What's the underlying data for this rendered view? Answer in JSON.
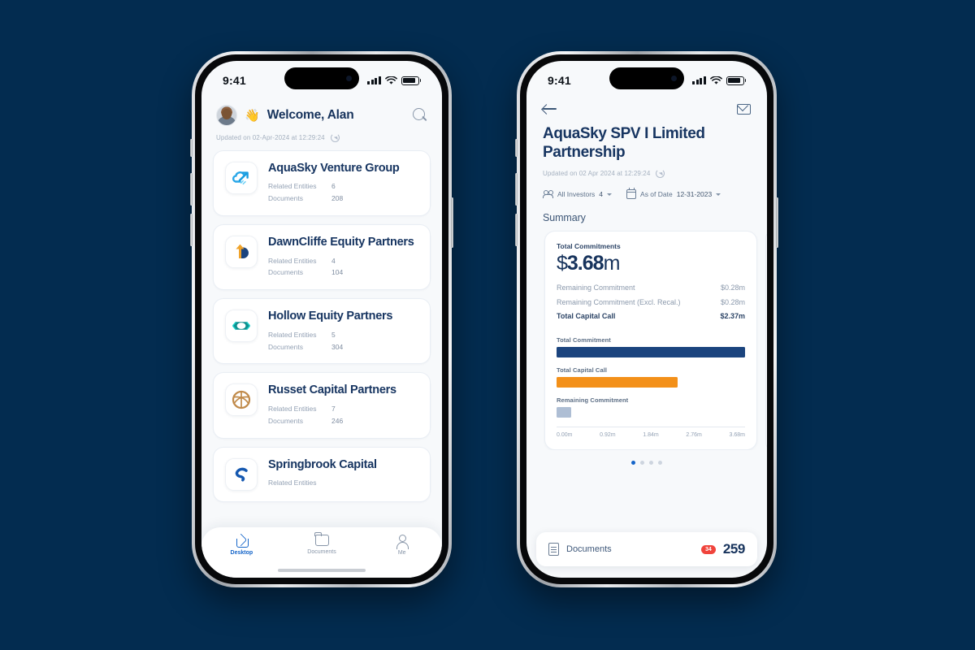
{
  "background_color": "#032c50",
  "accent_color": "#1565c9",
  "phone1": {
    "status_bar": {
      "time": "9:41",
      "signal_icon": "cellular-signal-icon",
      "wifi_icon": "wifi-icon",
      "battery_icon": "battery-icon"
    },
    "header": {
      "avatar": "user-avatar",
      "wave_emoji": "👋",
      "greeting": "Welcome, Alan",
      "search_icon": "search-icon"
    },
    "updated": {
      "text": "Updated on 02-Apr-2024 at 12:29:24",
      "refresh_icon": "refresh-icon"
    },
    "labels": {
      "related_entities": "Related Entities",
      "documents": "Documents"
    },
    "cards": [
      {
        "name": "AquaSky Venture Group",
        "logo": "cloud-arrow-logo",
        "related_entities": "6",
        "documents": "208"
      },
      {
        "name": "DawnCliffe Equity Partners",
        "logo": "arrow-d-logo",
        "related_entities": "4",
        "documents": "104"
      },
      {
        "name": "Hollow Equity Partners",
        "logo": "teal-hexagon-logo",
        "related_entities": "5",
        "documents": "304"
      },
      {
        "name": "Russet Capital Partners",
        "logo": "bronze-circle-logo",
        "related_entities": "7",
        "documents": "246"
      },
      {
        "name": "Springbrook Capital",
        "logo": "blue-s-logo",
        "related_entities": "",
        "documents": ""
      }
    ],
    "tabbar": [
      {
        "label": "Desktop",
        "icon": "home-icon",
        "active": true
      },
      {
        "label": "Documents",
        "icon": "folder-icon",
        "active": false
      },
      {
        "label": "Me",
        "icon": "person-icon",
        "active": false
      }
    ]
  },
  "phone2": {
    "status_bar": {
      "time": "9:41",
      "signal_icon": "cellular-signal-icon",
      "wifi_icon": "wifi-icon",
      "battery_icon": "battery-icon"
    },
    "nav": {
      "back_icon": "back-arrow-icon",
      "mail_icon": "mail-icon"
    },
    "title": "AquaSky SPV I Limited Partnership",
    "updated": {
      "text": "Updated on 02 Apr 2024 at 12:29:24",
      "refresh_icon": "refresh-icon"
    },
    "filters": [
      {
        "icon": "investors-group-icon",
        "label": "All Investors",
        "value": "4",
        "chevron": "chevron-down-icon"
      },
      {
        "icon": "calendar-icon",
        "label": "As of Date",
        "value": "12-31-2023",
        "chevron": "chevron-down-icon"
      }
    ],
    "section_title": "Summary",
    "summary": {
      "total_commitments_label": "Total Commitments",
      "total_commitments_currency": "$",
      "total_commitments_value": "3.68",
      "total_commitments_suffix": "m",
      "rows": [
        {
          "label": "Remaining Commitment",
          "value": "$0.28m",
          "strong": false
        },
        {
          "label": "Remaining Commitment (Excl. Recal.)",
          "value": "$0.28m",
          "strong": false
        },
        {
          "label": "Total Capital Call",
          "value": "$2.37m",
          "strong": true
        }
      ]
    },
    "pager": {
      "count": 4,
      "active_index": 0
    },
    "documents_bar": {
      "icon": "document-icon",
      "label": "Documents",
      "badge": "34",
      "count": "259"
    }
  },
  "chart_data": {
    "type": "bar",
    "title": "",
    "orientation": "horizontal",
    "categories": [
      "Total Commitment",
      "Total Capital Call",
      "Remaining Commitment"
    ],
    "values": [
      3.68,
      2.37,
      0.28
    ],
    "colors": [
      "#1b447e",
      "#f39019",
      "#aebed4"
    ],
    "xlabel": "",
    "ylabel": "",
    "xlim": [
      0,
      3.68
    ],
    "tick_labels": [
      "0.00m",
      "0.92m",
      "1.84m",
      "2.76m",
      "3.68m"
    ],
    "grid": false,
    "legend": "none",
    "unit": "m"
  }
}
